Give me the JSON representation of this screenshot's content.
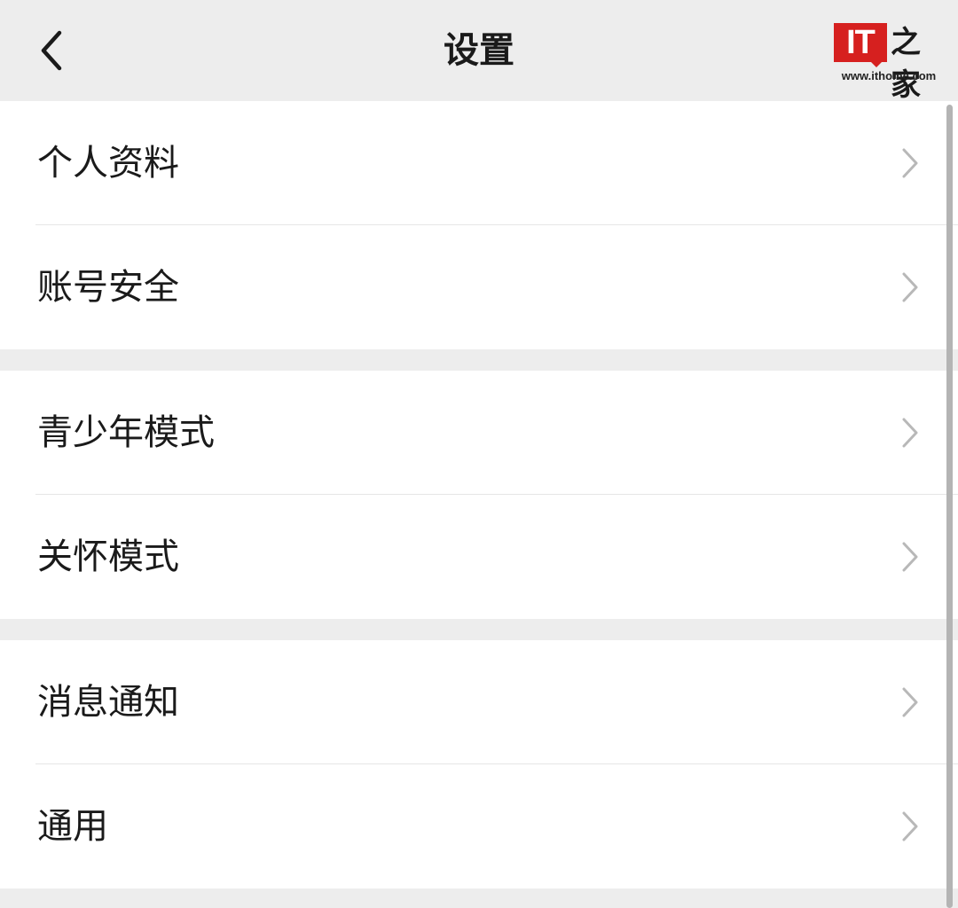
{
  "header": {
    "title": "设置",
    "back_icon": "chevron-left-icon"
  },
  "watermark": {
    "logo_text": "IT",
    "logo_cn": "之家",
    "url": "www.ithome.com",
    "brand_color": "#d6201f"
  },
  "groups": [
    {
      "items": [
        {
          "label": "个人资料",
          "icon": "chevron-right-icon"
        },
        {
          "label": "账号安全",
          "icon": "chevron-right-icon"
        }
      ]
    },
    {
      "items": [
        {
          "label": "青少年模式",
          "icon": "chevron-right-icon"
        },
        {
          "label": "关怀模式",
          "icon": "chevron-right-icon"
        }
      ]
    },
    {
      "items": [
        {
          "label": "消息通知",
          "icon": "chevron-right-icon"
        },
        {
          "label": "通用",
          "icon": "chevron-right-icon"
        }
      ]
    }
  ],
  "colors": {
    "background": "#ededed",
    "card": "#ffffff",
    "text": "#1a1a1a",
    "chevron": "#b8b8b8"
  }
}
